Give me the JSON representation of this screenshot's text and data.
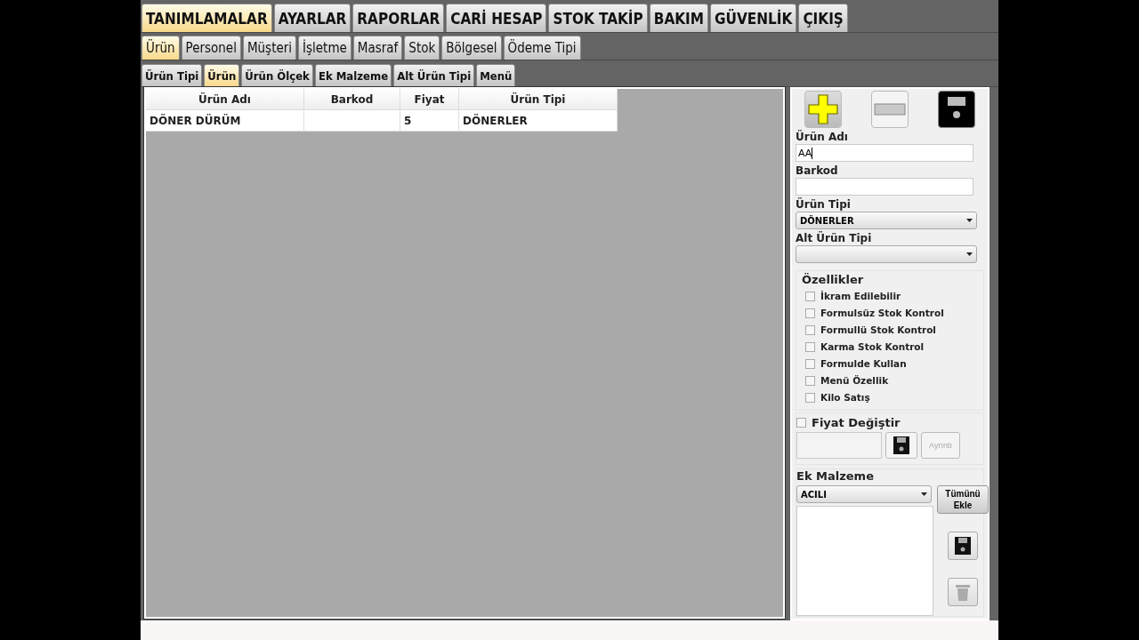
{
  "menu_tabs": [
    {
      "label": "TANIMLAMALAR",
      "selected": true
    },
    {
      "label": "AYARLAR",
      "selected": false
    },
    {
      "label": "RAPORLAR",
      "selected": false
    },
    {
      "label": "CARİ HESAP",
      "selected": false
    },
    {
      "label": "STOK TAKİP",
      "selected": false
    },
    {
      "label": "BAKIM",
      "selected": false
    },
    {
      "label": "GÜVENLİK",
      "selected": false
    },
    {
      "label": "ÇIKIŞ",
      "selected": false
    }
  ],
  "sub_tabs": [
    {
      "label": "Ürün",
      "selected": true
    },
    {
      "label": "Personel",
      "selected": false
    },
    {
      "label": "Müşteri",
      "selected": false
    },
    {
      "label": "İşletme",
      "selected": false
    },
    {
      "label": "Masraf",
      "selected": false
    },
    {
      "label": "Stok",
      "selected": false
    },
    {
      "label": "Bölgesel",
      "selected": false
    },
    {
      "label": "Ödeme Tipi",
      "selected": false
    }
  ],
  "section_tabs": [
    {
      "label": "Ürün Tipi",
      "selected": false
    },
    {
      "label": "Ürün",
      "selected": true
    },
    {
      "label": "Ürün Ölçek",
      "selected": false
    },
    {
      "label": "Ek Malzeme",
      "selected": false
    },
    {
      "label": "Alt Ürün Tipi",
      "selected": false
    },
    {
      "label": "Menü",
      "selected": false
    }
  ],
  "table": {
    "columns": [
      "Ürün Adı",
      "Barkod",
      "Fiyat",
      "Ürün Tipi"
    ],
    "rows": [
      [
        "DÖNER DÜRÜM",
        "",
        "5",
        "DÖNERLER"
      ]
    ]
  },
  "form": {
    "urun_adi": {
      "label": "Ürün Adı",
      "value": "AA"
    },
    "barkod": {
      "label": "Barkod"
    },
    "urun_tipi": {
      "label": "Ürün Tipi",
      "value": "DÖNERLER"
    },
    "alt_urun_tipi": {
      "label": "Alt Ürün Tipi"
    }
  },
  "ozellikler": {
    "title": "Özellikler",
    "items": [
      {
        "label": "İkram Edilebilir",
        "checked": false
      },
      {
        "label": "Formulsüz Stok Kontrol",
        "checked": false
      },
      {
        "label": "Formullü Stok Kontrol",
        "checked": false
      },
      {
        "label": "Karma Stok Kontrol",
        "checked": false
      },
      {
        "label": "Formulde Kullan",
        "checked": false
      },
      {
        "label": "Menü Özellik",
        "checked": false
      },
      {
        "label": "Kilo Satış",
        "checked": false
      }
    ]
  },
  "fiyat_degistir": {
    "label": "Fiyat Değiştir",
    "checked": false,
    "detail_button": {
      "label": "Ayrıntı",
      "disabled": true
    }
  },
  "ek_malzeme": {
    "title": "Ek Malzeme",
    "value": "ACILI",
    "add_all_button": "Tümünü Ekle"
  }
}
